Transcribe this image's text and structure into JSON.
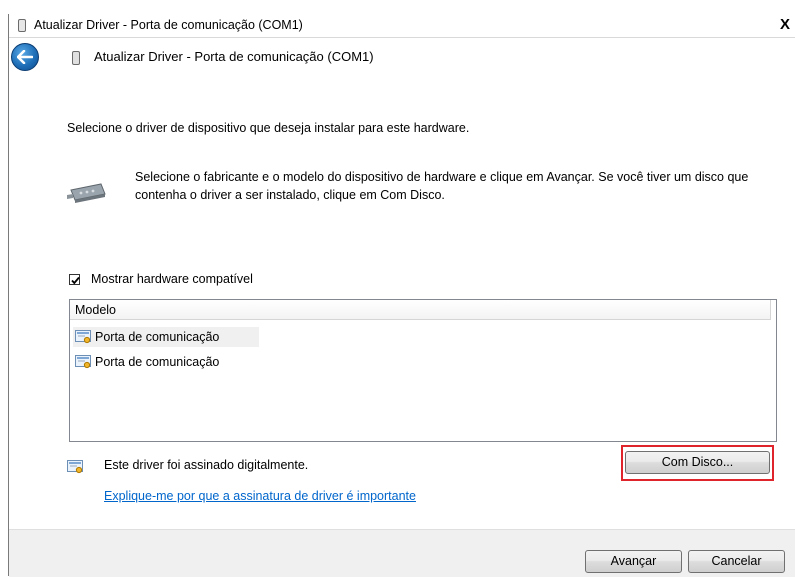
{
  "window": {
    "title": "Atualizar Driver - Porta de comunicação (COM1)",
    "close_glyph": "X"
  },
  "nav": {
    "back_icon": "back-arrow-icon",
    "title": "Atualizar Driver - Porta de comunicação (COM1)"
  },
  "content": {
    "instruction": "Selecione o driver de dispositivo que deseja instalar para este hardware.",
    "description": "Selecione o fabricante e o modelo do dispositivo de hardware e clique em Avançar. Se você tiver um disco que contenha o driver a ser instalado, clique em Com Disco.",
    "show_compatible": {
      "label": "Mostrar hardware compatível",
      "checked": true
    },
    "model_list": {
      "header": "Modelo",
      "items": [
        {
          "label": "Porta de comunicação",
          "selected": true
        },
        {
          "label": "Porta de comunicação",
          "selected": false
        }
      ]
    },
    "signed_text": "Este driver foi assinado digitalmente.",
    "signing_link": "Explique-me por que a assinatura de driver é importante",
    "have_disk_button": "Com Disco..."
  },
  "footer": {
    "next_button": "Avançar",
    "cancel_button": "Cancelar"
  },
  "colors": {
    "highlight": "#e0242c",
    "link": "#0066cc"
  }
}
